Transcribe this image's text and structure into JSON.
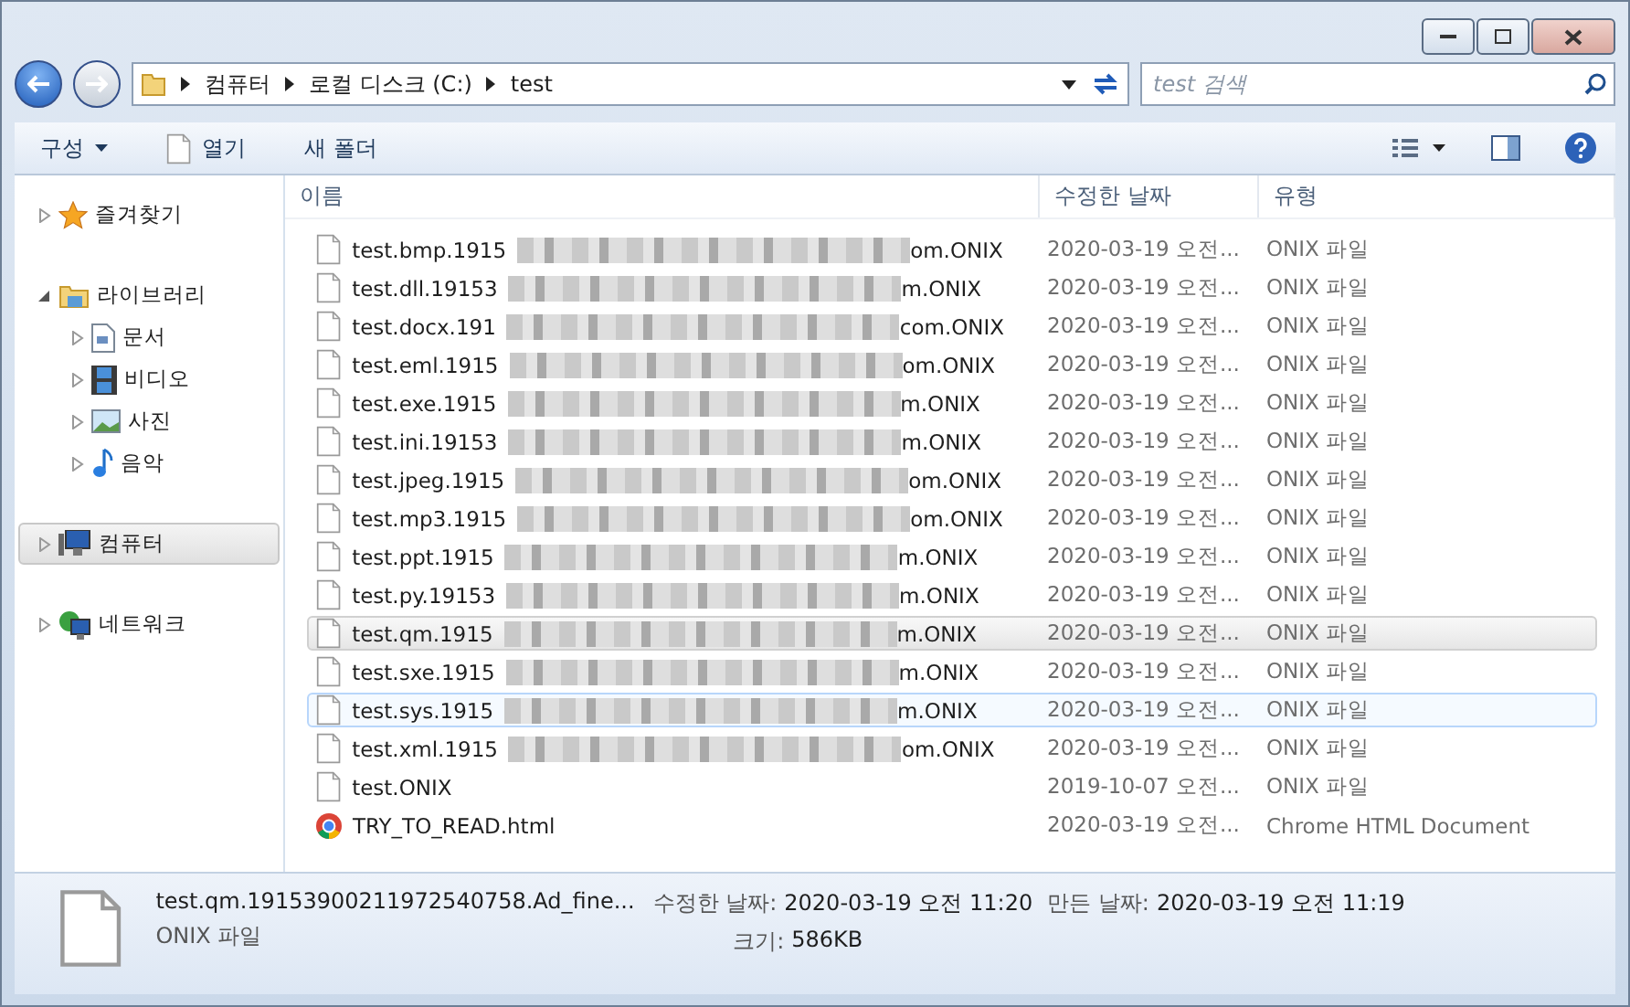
{
  "breadcrumb": [
    "컴퓨터",
    "로컬 디스크 (C:)",
    "test"
  ],
  "search": {
    "placeholder": "test 검색"
  },
  "toolbar": [
    {
      "label": "구성",
      "kind": "menu"
    },
    {
      "label": "열기",
      "kind": "open"
    },
    {
      "label": "새 폴더",
      "kind": "plain"
    }
  ],
  "sidebar": {
    "items": [
      {
        "label": "즐겨찾기",
        "kind": "star",
        "expanded": false,
        "selected": false
      },
      {
        "label": "라이브러리",
        "kind": "library",
        "expanded": true,
        "selected": false,
        "children": [
          {
            "label": "문서",
            "kind": "doc",
            "expanded": false,
            "selected": false
          },
          {
            "label": "비디오",
            "kind": "video",
            "expanded": false,
            "selected": false
          },
          {
            "label": "사진",
            "kind": "photo",
            "expanded": false,
            "selected": false
          },
          {
            "label": "음악",
            "kind": "music",
            "expanded": false,
            "selected": false
          }
        ]
      },
      {
        "label": "컴퓨터",
        "kind": "computer",
        "expanded": false,
        "selected": true
      },
      {
        "label": "네트워크",
        "kind": "network",
        "expanded": false,
        "selected": false
      }
    ]
  },
  "table": {
    "columns": [
      "이름",
      "수정한 날짜",
      "유형"
    ],
    "rows": [
      {
        "name_start": "test.bmp.1915",
        "name_end": "om.ONIX",
        "blurred": true,
        "date": "2020-03-19 오전...",
        "type": "ONIX 파일",
        "kind": "file",
        "selected": false,
        "hovered": false
      },
      {
        "name_start": "test.dll.19153",
        "name_end": "m.ONIX",
        "blurred": true,
        "date": "2020-03-19 오전...",
        "type": "ONIX 파일",
        "kind": "file",
        "selected": false,
        "hovered": false
      },
      {
        "name_start": "test.docx.191",
        "name_end": "com.ONIX",
        "blurred": true,
        "date": "2020-03-19 오전...",
        "type": "ONIX 파일",
        "kind": "file",
        "selected": false,
        "hovered": false
      },
      {
        "name_start": "test.eml.1915",
        "name_end": "om.ONIX",
        "blurred": true,
        "date": "2020-03-19 오전...",
        "type": "ONIX 파일",
        "kind": "file",
        "selected": false,
        "hovered": false
      },
      {
        "name_start": "test.exe.1915",
        "name_end": "m.ONIX",
        "blurred": true,
        "date": "2020-03-19 오전...",
        "type": "ONIX 파일",
        "kind": "file",
        "selected": false,
        "hovered": false
      },
      {
        "name_start": "test.ini.19153",
        "name_end": "m.ONIX",
        "blurred": true,
        "date": "2020-03-19 오전...",
        "type": "ONIX 파일",
        "kind": "file",
        "selected": false,
        "hovered": false
      },
      {
        "name_start": "test.jpeg.1915",
        "name_end": "om.ONIX",
        "blurred": true,
        "date": "2020-03-19 오전...",
        "type": "ONIX 파일",
        "kind": "file",
        "selected": false,
        "hovered": false
      },
      {
        "name_start": "test.mp3.1915",
        "name_end": "om.ONIX",
        "blurred": true,
        "date": "2020-03-19 오전...",
        "type": "ONIX 파일",
        "kind": "file",
        "selected": false,
        "hovered": false
      },
      {
        "name_start": "test.ppt.1915",
        "name_end": "m.ONIX",
        "blurred": true,
        "date": "2020-03-19 오전...",
        "type": "ONIX 파일",
        "kind": "file",
        "selected": false,
        "hovered": false
      },
      {
        "name_start": "test.py.19153",
        "name_end": "m.ONIX",
        "blurred": true,
        "date": "2020-03-19 오전...",
        "type": "ONIX 파일",
        "kind": "file",
        "selected": false,
        "hovered": false
      },
      {
        "name_start": "test.qm.1915",
        "name_end": "m.ONIX",
        "blurred": true,
        "date": "2020-03-19 오전...",
        "type": "ONIX 파일",
        "kind": "file",
        "selected": true,
        "hovered": false
      },
      {
        "name_start": "test.sxe.1915",
        "name_end": "m.ONIX",
        "blurred": true,
        "date": "2020-03-19 오전...",
        "type": "ONIX 파일",
        "kind": "file",
        "selected": false,
        "hovered": false
      },
      {
        "name_start": "test.sys.1915",
        "name_end": "m.ONIX",
        "blurred": true,
        "date": "2020-03-19 오전...",
        "type": "ONIX 파일",
        "kind": "file",
        "selected": false,
        "hovered": true
      },
      {
        "name_start": "test.xml.1915",
        "name_end": "om.ONIX",
        "blurred": true,
        "date": "2020-03-19 오전...",
        "type": "ONIX 파일",
        "kind": "file",
        "selected": false,
        "hovered": false
      },
      {
        "name_start": "test.ONIX",
        "blurred": false,
        "date": "2019-10-07 오전...",
        "type": "ONIX 파일",
        "kind": "file",
        "selected": false,
        "hovered": false
      },
      {
        "name_start": "TRY_TO_READ.html",
        "blurred": false,
        "date": "2020-03-19 오전...",
        "type": "Chrome HTML Document",
        "kind": "chrome",
        "selected": false,
        "hovered": false
      }
    ]
  },
  "details": {
    "name": "test.qm.19153900211972540758.Ad_fine...",
    "type": "ONIX 파일",
    "modified_label": "수정한 날짜:",
    "modified": "2020-03-19 오전 11:20",
    "created_label": "만든 날짜:",
    "created": "2020-03-19 오전 11:19",
    "size_label": "크기:",
    "size": "586KB"
  }
}
